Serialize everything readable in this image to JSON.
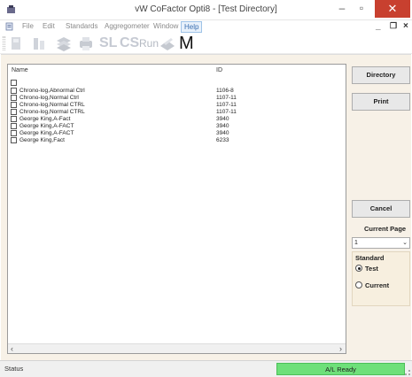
{
  "window": {
    "title": "vW CoFactor Opti8 - [Test Directory]"
  },
  "menu": {
    "file": "File",
    "edit": "Edit",
    "standards": "Standards",
    "aggregometer": "Aggregometer",
    "window": "Window",
    "help": "Help"
  },
  "toolbar": {
    "sl": "SL",
    "cs": "CS",
    "run": "Run",
    "m": "M"
  },
  "list": {
    "columns": {
      "name": "Name",
      "id": "ID"
    },
    "rows": [
      {
        "name": "",
        "id": ""
      },
      {
        "name": "Chrono-log,Abnormal Ctrl",
        "id": "1106-8"
      },
      {
        "name": "Chrono-log,Normal Ctrl",
        "id": "1107-11"
      },
      {
        "name": "Chrono-log,Normal CTRL",
        "id": "1107-11"
      },
      {
        "name": "Chrono-log,Normal CTRL",
        "id": "1107-11"
      },
      {
        "name": "George King,A-Fact",
        "id": "3940"
      },
      {
        "name": "George King,A-FACT",
        "id": "3940"
      },
      {
        "name": "George King,A-FACT",
        "id": "3940"
      },
      {
        "name": "George King,Fact",
        "id": "6233"
      }
    ]
  },
  "side": {
    "directory": "Directory",
    "print": "Print",
    "cancel": "Cancel",
    "current_page_label": "Current Page",
    "current_page_value": "1",
    "standard": {
      "title": "Standard",
      "options": [
        {
          "label": "Test",
          "selected": true
        },
        {
          "label": "Current",
          "selected": false
        }
      ]
    }
  },
  "status": {
    "text": "Status",
    "ready": "A/L Ready",
    "ready_color": "#6ee07a"
  },
  "colors": {
    "close": "#c8402f",
    "client_bg": "#f7f1e7"
  }
}
